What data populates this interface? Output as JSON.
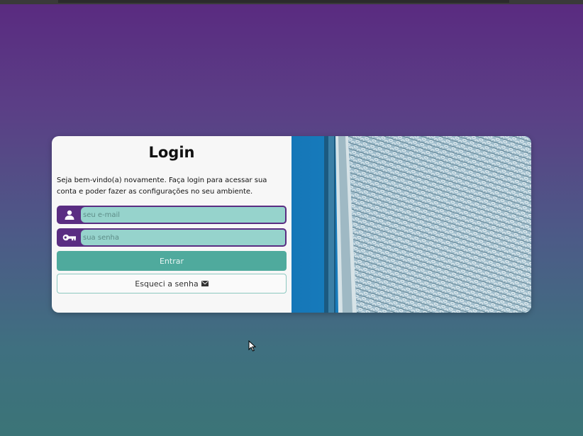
{
  "login": {
    "title": "Login",
    "subtitle": "Seja bem-vindo(a) novamente. Faça login para acessar sua conta e poder fazer as configurações no seu ambiente.",
    "email_placeholder": "seu e-mail",
    "password_placeholder": "sua senha",
    "login_button": "Entrar",
    "forgot_button": "Esqueci a senha",
    "icons": {
      "email": "user-icon",
      "password": "key-icon",
      "forgot": "envelope-icon"
    }
  },
  "colors": {
    "accent_purple": "#5a2d82",
    "input_bg": "#96d3cc",
    "button_teal": "#4faa9d"
  }
}
